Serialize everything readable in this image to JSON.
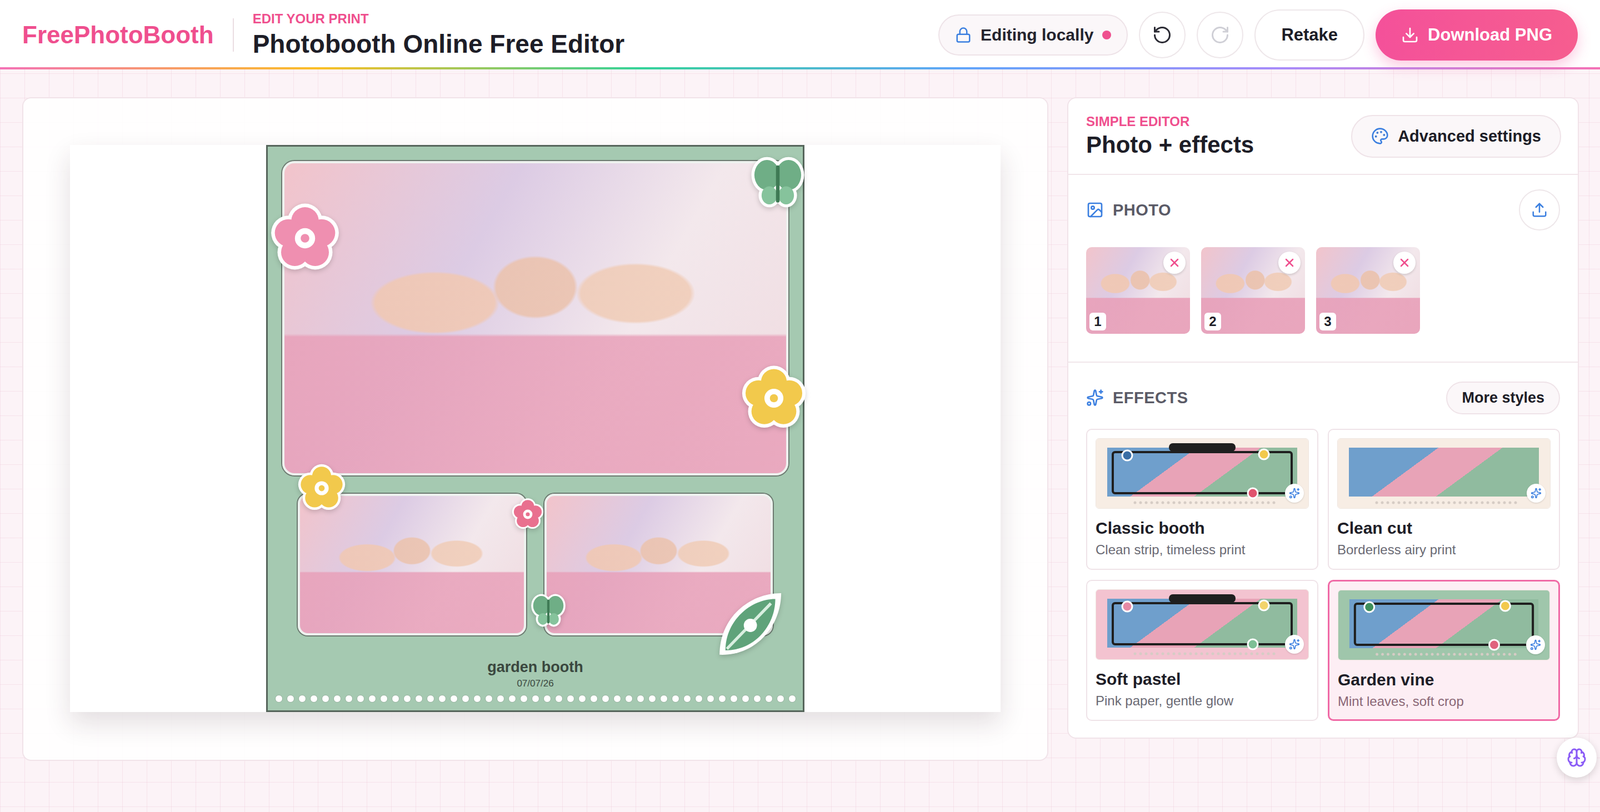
{
  "header": {
    "logo": "FreePhotoBooth",
    "eyebrow": "EDIT YOUR PRINT",
    "title": "Photobooth Online Free Editor",
    "status": {
      "label": "Editing locally",
      "on": true
    },
    "history": {
      "undo_disabled": false,
      "redo_disabled": true
    },
    "retake": "Retake",
    "download": "Download PNG"
  },
  "print": {
    "caption": "garden booth",
    "date": "07/07/26"
  },
  "editor": {
    "eyebrow": "SIMPLE EDITOR",
    "title": "Photo + effects",
    "advanced": "Advanced settings",
    "photo": {
      "label": "PHOTO",
      "thumbnails": [
        {
          "number": "1"
        },
        {
          "number": "2"
        },
        {
          "number": "3"
        }
      ]
    },
    "effects": {
      "label": "EFFECTS",
      "more": "More styles",
      "items": [
        {
          "name": "Classic booth",
          "description": "Clean strip, timeless print",
          "kind": "classic",
          "selected": false
        },
        {
          "name": "Clean cut",
          "description": "Borderless airy print",
          "kind": "clean",
          "selected": false
        },
        {
          "name": "Soft pastel",
          "description": "Pink paper, gentle glow",
          "kind": "soft",
          "selected": false
        },
        {
          "name": "Garden vine",
          "description": "Mint leaves, soft crop",
          "kind": "garden",
          "selected": true
        }
      ]
    }
  }
}
